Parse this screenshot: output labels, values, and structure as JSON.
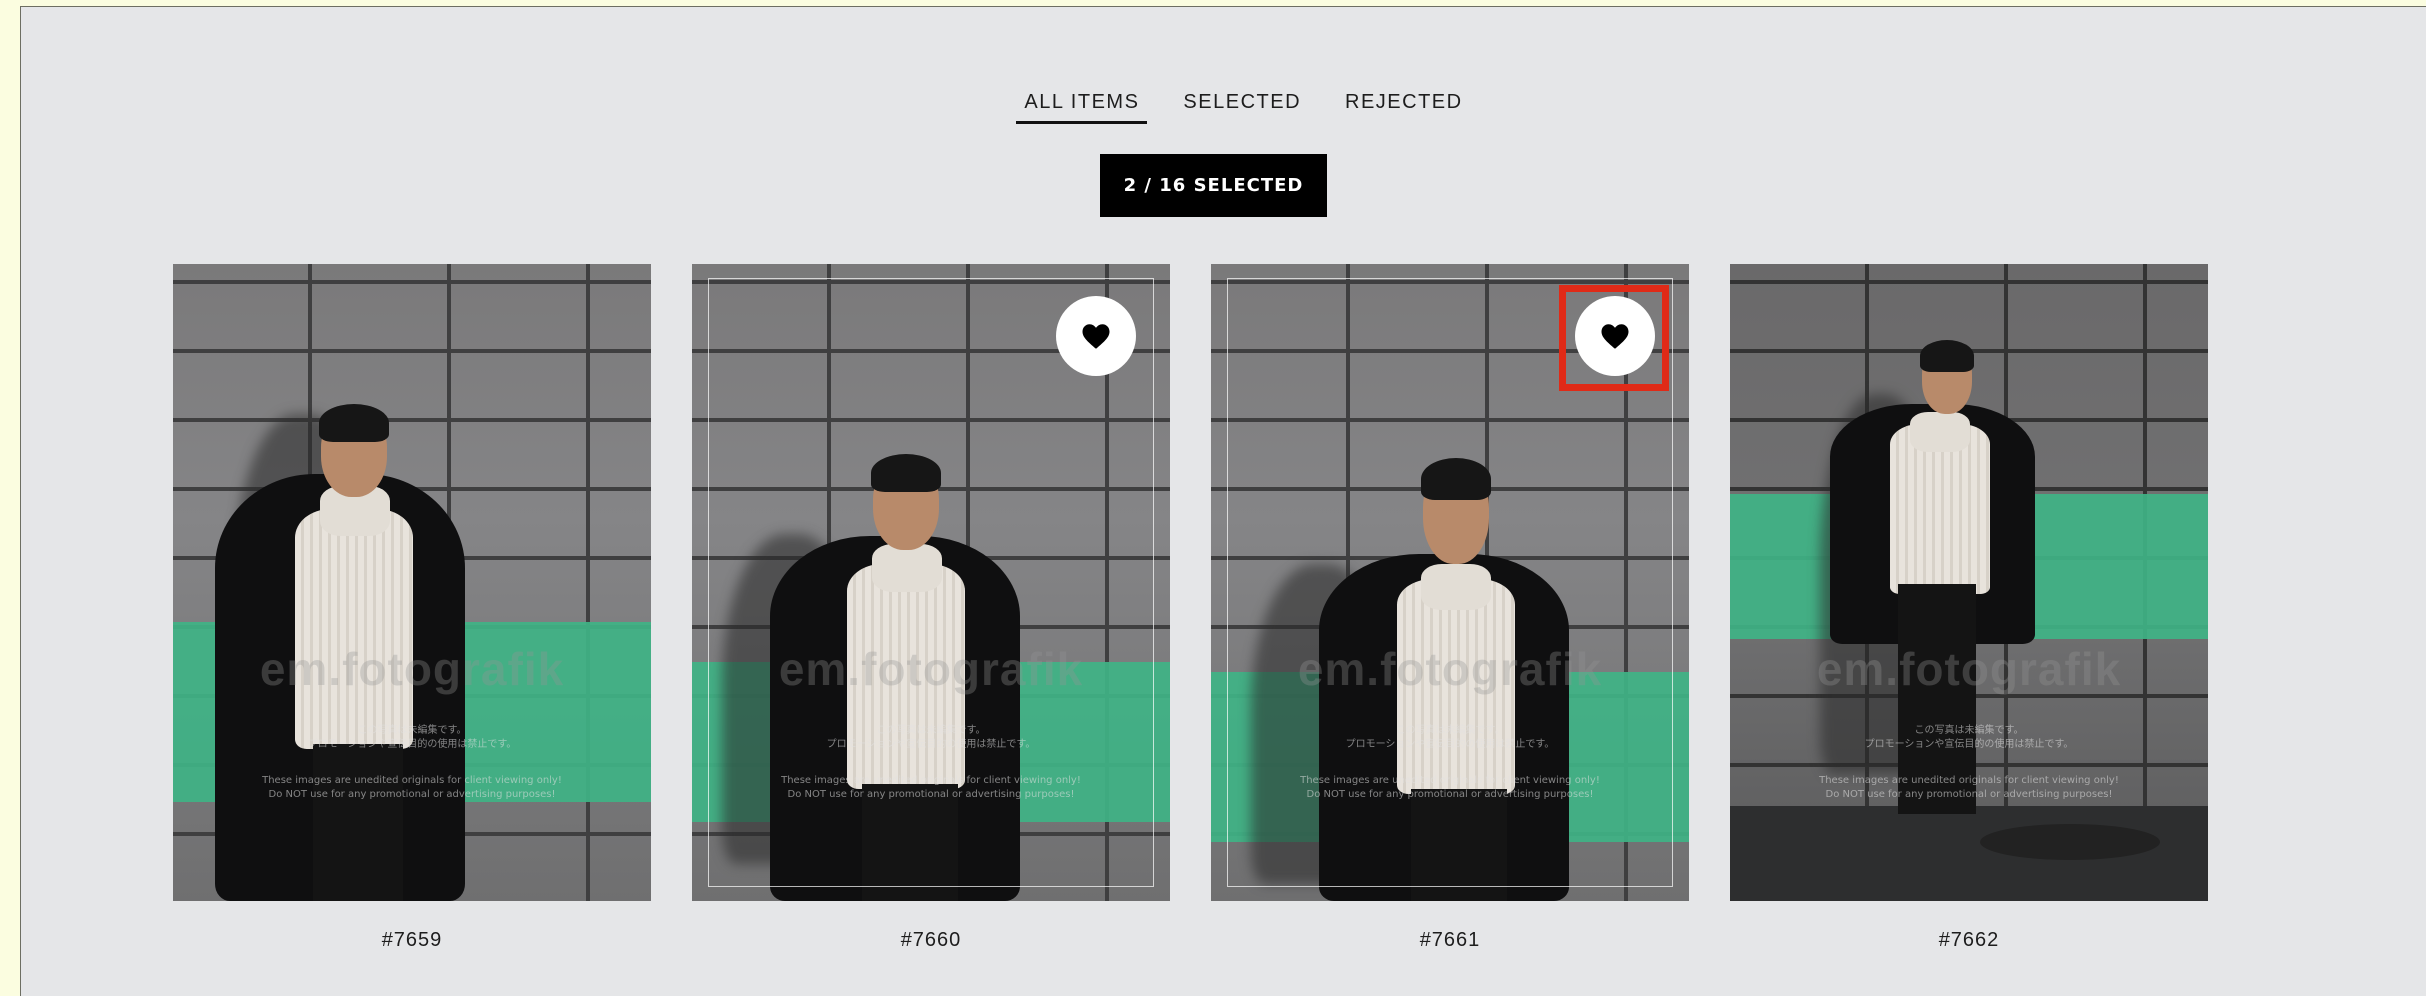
{
  "tabs": [
    {
      "label": "ALL ITEMS",
      "active": true
    },
    {
      "label": "SELECTED",
      "active": false
    },
    {
      "label": "REJECTED",
      "active": false
    }
  ],
  "counter": {
    "label": "2 / 16 SELECTED"
  },
  "photos": [
    {
      "caption": "#7659",
      "selected": false
    },
    {
      "caption": "#7660",
      "selected": true
    },
    {
      "caption": "#7661",
      "selected": true
    },
    {
      "caption": "#7662",
      "selected": false
    }
  ],
  "watermark": {
    "brand": "em.fotografik",
    "jp_line1": "この写真は未編集です。",
    "jp_line2": "プロモーションや宣伝目的の使用は禁止です。",
    "en_line1": "These images are unedited originals for client viewing only!",
    "en_line2": "Do NOT use for any promotional or advertising purposes!"
  },
  "colors": {
    "accent": "#000000",
    "highlight": "#e02a17",
    "stripe": "#3fb385",
    "background": "#e5e6e8"
  },
  "icons": {
    "select": "heart-icon"
  }
}
